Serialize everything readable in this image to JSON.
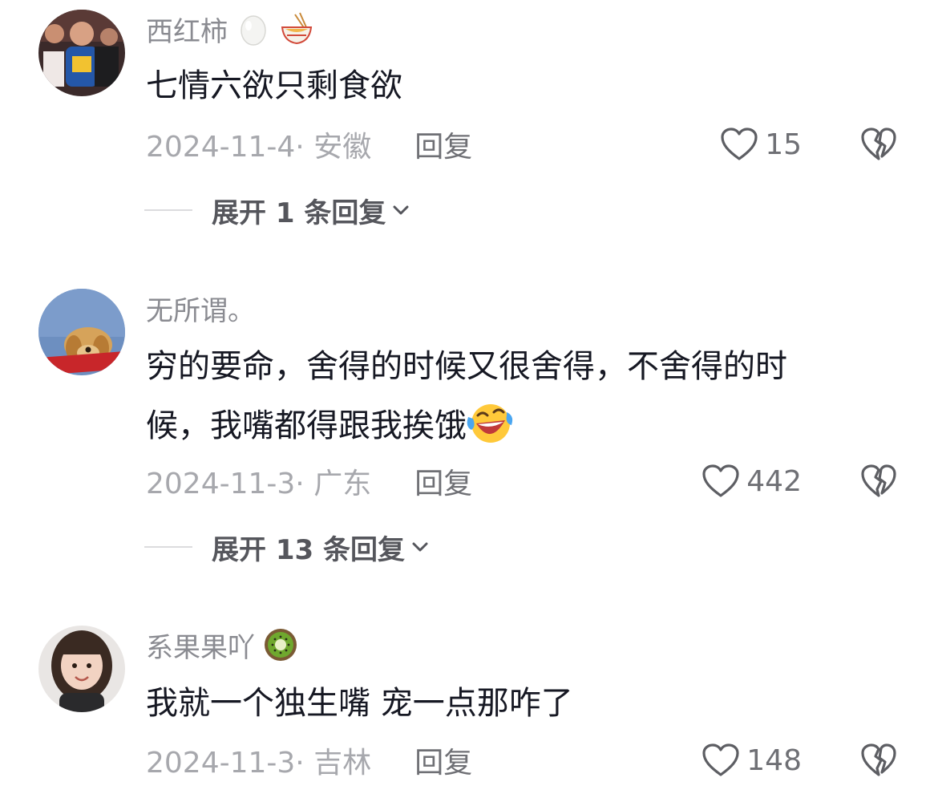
{
  "comments": [
    {
      "username": "西红柿",
      "username_icons": [
        "egg-icon",
        "noodle-bowl-icon"
      ],
      "text": "七情六欲只剩食欲",
      "date_location": "2024-11-4· 安徽",
      "reply_label": "回复",
      "likes": "15",
      "expand_label": "展开 1 条回复"
    },
    {
      "username": "无所谓。",
      "text_line1": "穷的要命，舍得的时候又很舍得，不舍得的时",
      "text_line2": "候，我嘴都得跟我挨饿",
      "text_emoji": "laughing-crying-face-icon",
      "date_location": "2024-11-3· 广东",
      "reply_label": "回复",
      "likes": "442",
      "expand_label": "展开 13 条回复"
    },
    {
      "username": "系果果吖",
      "username_icons": [
        "kiwi-icon"
      ],
      "text": "我就一个独生嘴 宠一点那咋了",
      "date_location": "2024-11-3· 吉林",
      "reply_label": "回复",
      "likes": "148"
    }
  ],
  "colors": {
    "username": "#8a8b91",
    "text": "#161823",
    "meta": "#a7a8ad",
    "icon": "#5d5e63"
  }
}
